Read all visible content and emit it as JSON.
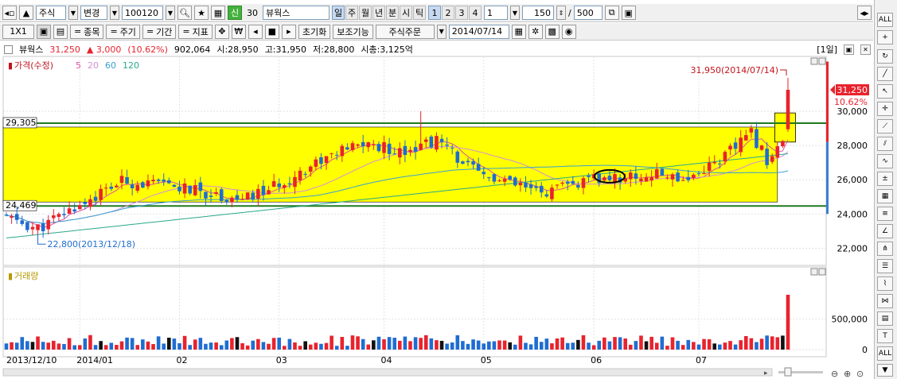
{
  "toolbar": {
    "market": "주식",
    "mode": "변경",
    "code": "100120",
    "credit": "신",
    "credit_ratio": "30",
    "name": "뷰웍스",
    "periods": [
      "일",
      "주",
      "월",
      "년",
      "분",
      "시",
      "틱"
    ],
    "minute_options": [
      "1",
      "2",
      "3",
      "4"
    ],
    "unit": "1",
    "count": "150",
    "max": "500",
    "slash": "/"
  },
  "toolbar2": {
    "layout": "1X1",
    "compare": "종목",
    "cycle": "주기",
    "period": "기간",
    "indicator": "지표",
    "currency": "₩",
    "reset": "초기화",
    "aux": "보조기능",
    "order": "주식주문",
    "date": "2014/07/14"
  },
  "info": {
    "name": "뷰웍스",
    "price": "31,250",
    "change": "▲ 3,000",
    "pct": "(10.62%)",
    "volume": "902,064",
    "open": "시:28,950",
    "high": "고:31,950",
    "low": "저:28,800",
    "mcap": "시총:3,125억",
    "tag": "[1일]"
  },
  "price_panel": {
    "title": "가격(수정)",
    "ma": [
      "5",
      "20",
      "60",
      "120"
    ],
    "ma_colors": [
      "#e0509b",
      "#d38fd8",
      "#3aa0d0",
      "#29a88b"
    ],
    "high_note": "31,950(2014/07/14)",
    "low_note": "22,800(2013/12/18)",
    "level_upper": "29,305",
    "level_lower": "24,469",
    "last_price": "31,250",
    "last_pct": "10.62%"
  },
  "volume_panel": {
    "title": "거래량"
  },
  "colors": {
    "up": "#e8232d",
    "down": "#1f6dd1",
    "box": "#ffff00",
    "level": "#1f7a1f"
  },
  "chart_data": [
    {
      "type": "candlestick",
      "title": "가격(수정)",
      "x_ticks": [
        "2013/12/10",
        "2014/01",
        "02",
        "03",
        "04",
        "05",
        "06",
        "07"
      ],
      "y_ticks": [
        "22,000",
        "24,000",
        "26,000",
        "28,000",
        "30,000"
      ],
      "ylim": [
        21000,
        33200
      ],
      "levels": [
        29305,
        24469
      ],
      "series": [
        {
          "name": "가격",
          "summary": {
            "first": "2013/12/10",
            "last": "2014/07/14",
            "high": 31950,
            "low": 22800,
            "last_close": 31250
          }
        },
        {
          "name": "5"
        },
        {
          "name": "20"
        },
        {
          "name": "60"
        },
        {
          "name": "120"
        }
      ]
    },
    {
      "type": "bar",
      "title": "거래량",
      "y_ticks": [
        "0",
        "500,000"
      ],
      "ylim": [
        0,
        1150000
      ],
      "last_value": 902064
    }
  ]
}
